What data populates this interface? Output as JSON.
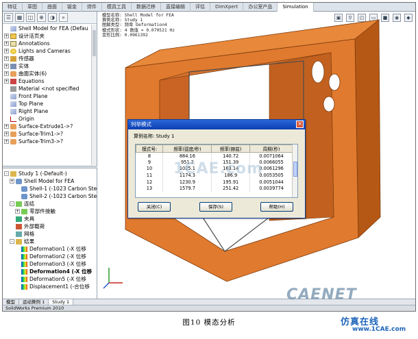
{
  "tabs": [
    "特征",
    "草图",
    "曲面",
    "钣金",
    "焊件",
    "模具工具",
    "数据迁移",
    "直接编辑",
    "评估",
    "DimXpert",
    "办公室产品",
    "Simulation"
  ],
  "active_tab_index": 11,
  "feature_tree": [
    {
      "label": "Shell Model for FEA  (Defau",
      "icon": "part-icon",
      "expand": ""
    },
    {
      "label": "设计活页夹",
      "icon": "folder-icon",
      "expand": "+"
    },
    {
      "label": "Annotations",
      "icon": "annotation-icon",
      "expand": "+"
    },
    {
      "label": "Lights and Cameras",
      "icon": "light-icon",
      "expand": "+"
    },
    {
      "label": "传感器",
      "icon": "sensor-icon",
      "expand": "+"
    },
    {
      "label": "实体",
      "icon": "solid-bodies-icon",
      "expand": "+"
    },
    {
      "label": "曲面实体(6)",
      "icon": "surface-bodies-icon",
      "expand": "+"
    },
    {
      "label": "Equations",
      "icon": "equations-icon",
      "expand": "+"
    },
    {
      "label": "Material <not specified",
      "icon": "material-icon",
      "expand": ""
    },
    {
      "label": "Front Plane",
      "icon": "plane-icon",
      "expand": ""
    },
    {
      "label": "Top Plane",
      "icon": "plane-icon",
      "expand": ""
    },
    {
      "label": "Right Plane",
      "icon": "plane-icon",
      "expand": ""
    },
    {
      "label": "Origin",
      "icon": "origin-icon",
      "expand": ""
    },
    {
      "label": "Surface-Extrude1->?",
      "icon": "surface-icon",
      "expand": "+"
    },
    {
      "label": "Surface-Trim1->?",
      "icon": "surface-icon",
      "expand": "+"
    },
    {
      "label": "Surface-Trim3->?",
      "icon": "surface-icon",
      "expand": "+"
    }
  ],
  "sim_tree": [
    {
      "label": "Study 1 (-Default-)",
      "icon": "study-icon",
      "expand": "-",
      "bold": false,
      "indent": 0
    },
    {
      "label": "Shell Model for FEA",
      "icon": "shell-icon",
      "expand": "+",
      "bold": false,
      "indent": 1
    },
    {
      "label": "Shell-1 (-1023 Carbon Stee",
      "icon": "shell-icon",
      "expand": "",
      "bold": false,
      "indent": 2
    },
    {
      "label": "Shell-2 (-1023 Carbon Stee",
      "icon": "shell-icon",
      "expand": "",
      "bold": false,
      "indent": 2
    },
    {
      "label": "连结",
      "icon": "connection-icon",
      "expand": "-",
      "bold": false,
      "indent": 1
    },
    {
      "label": "零部件接触",
      "icon": "connection-icon",
      "expand": "+",
      "bold": false,
      "indent": 2
    },
    {
      "label": "夹具",
      "icon": "fixture-icon",
      "expand": "",
      "bold": false,
      "indent": 1
    },
    {
      "label": "外部载荷",
      "icon": "load-icon",
      "expand": "",
      "bold": false,
      "indent": 1
    },
    {
      "label": "网格",
      "icon": "mesh-icon",
      "expand": "",
      "bold": false,
      "indent": 1
    },
    {
      "label": "结果",
      "icon": "results-icon",
      "expand": "-",
      "bold": false,
      "indent": 1
    },
    {
      "label": "Deformation1 (-X 位移",
      "icon": "deformation-icon",
      "expand": "",
      "bold": false,
      "indent": 2
    },
    {
      "label": "Deformation2 (-X 位移",
      "icon": "deformation-icon",
      "expand": "",
      "bold": false,
      "indent": 2
    },
    {
      "label": "Deformation3 (-X 位移",
      "icon": "deformation-icon",
      "expand": "",
      "bold": false,
      "indent": 2
    },
    {
      "label": "Deformation4 (-X 位移",
      "icon": "deformation-icon",
      "expand": "",
      "bold": true,
      "indent": 2
    },
    {
      "label": "Deformation5 (-X 位移",
      "icon": "deformation-icon",
      "expand": "",
      "bold": false,
      "indent": 2
    },
    {
      "label": "Displacement1 (-合位移",
      "icon": "deformation-icon",
      "expand": "",
      "bold": false,
      "indent": 2
    }
  ],
  "bottom_tabs": [
    "模型",
    "运动算例 1",
    "Study 1"
  ],
  "active_bottom_tab": 2,
  "status_text": "SolidWorks Premium 2010",
  "info_overlay": [
    "模型名称: Shell Model for FEA",
    "算例名称: Study 1",
    "图解类型: 频率 Deformation4",
    "模式形状: 4  数值 =      0.070521 Hz",
    "变形比例: 0.0961392"
  ],
  "dialog": {
    "title": "列举模式",
    "study_line": "算例名称:  Study 1",
    "columns": [
      "模式号:",
      "频率(弧度/秒)",
      "频率(赫兹)",
      "周期(秒)"
    ],
    "rows": [
      [
        "8",
        "884.16",
        "140.72",
        "0.0071064"
      ],
      [
        "9",
        "951.2",
        "151.39",
        "0.0066055"
      ],
      [
        "10",
        "1025.1",
        "163.14",
        "0.0061296"
      ],
      [
        "11",
        "1174.3",
        "186.9",
        "0.0053505"
      ],
      [
        "12",
        "1230.9",
        "195.91",
        "0.0051044"
      ],
      [
        "13",
        "1579.7",
        "251.42",
        "0.0039774"
      ]
    ],
    "buttons": [
      "关闭(C)",
      "保存(S)",
      "帮助(H)"
    ]
  },
  "caption": "图10   模态分析",
  "watermarks": {
    "center": "1CAE.com",
    "bottom": "CAENET",
    "site_cn": "仿真在线",
    "site_url": "www.1CAE.com"
  },
  "colors": {
    "model_face": "#e07a2e",
    "model_dark": "#a94f14",
    "dialog_title": "#0a3fb4"
  }
}
